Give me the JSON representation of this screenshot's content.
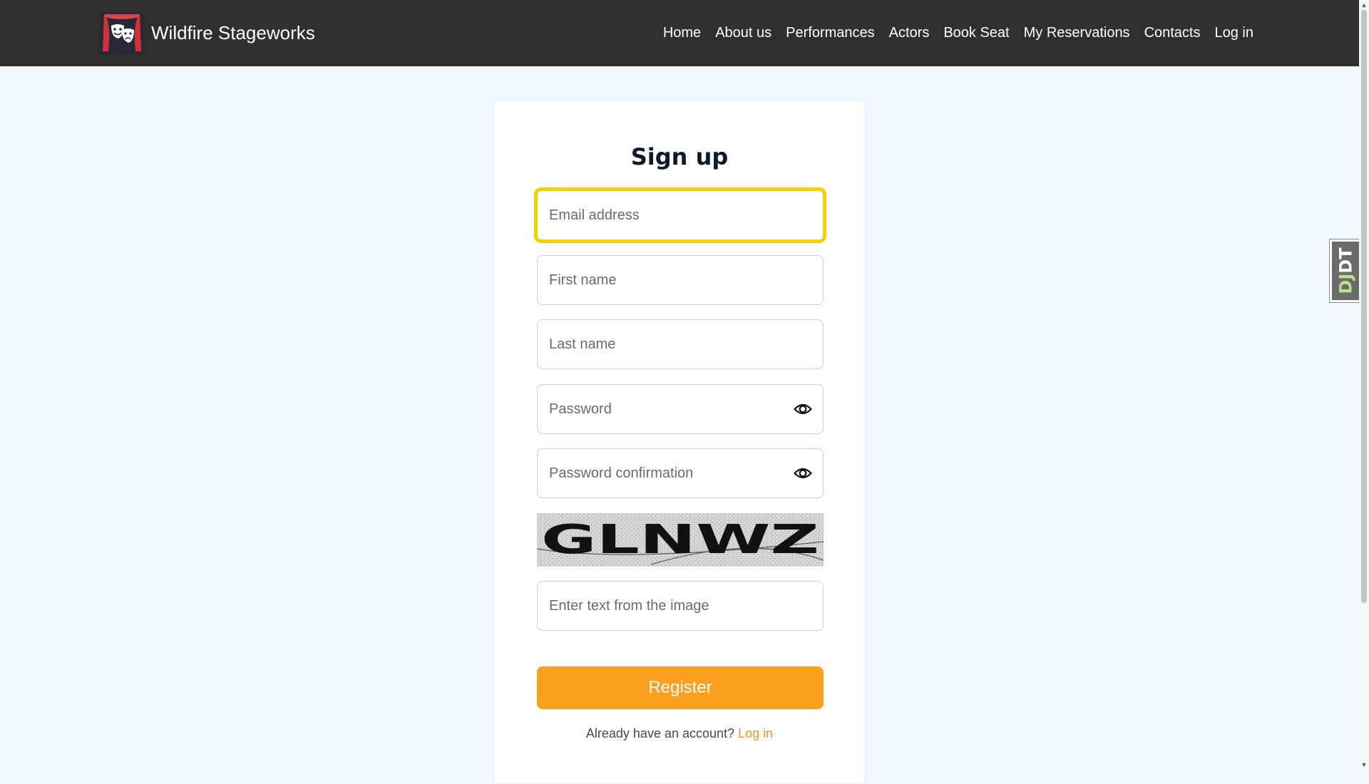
{
  "navbar": {
    "brand": "Wildfire Stageworks",
    "logo_icon": "theater-masks-icon",
    "items": [
      {
        "label": "Home"
      },
      {
        "label": "About us"
      },
      {
        "label": "Performances"
      },
      {
        "label": "Actors"
      },
      {
        "label": "Book Seat"
      },
      {
        "label": "My Reservations"
      },
      {
        "label": "Contacts"
      },
      {
        "label": "Log in"
      }
    ]
  },
  "form": {
    "title": "Sign up",
    "email_placeholder": "Email address",
    "first_name_placeholder": "First name",
    "last_name_placeholder": "Last name",
    "password_placeholder": "Password",
    "password_confirmation_placeholder": "Password confirmation",
    "captcha_text": "GLNWZ",
    "captcha_input_placeholder": "Enter text from the image",
    "register_label": "Register",
    "login_prompt": "Already have an account?",
    "login_link": "Log in"
  },
  "debug_toolbar": {
    "label_prefix": "DJ",
    "label_suffix": "DT"
  },
  "colors": {
    "navbar_bg": "#2f2f2f",
    "page_bg": "#f0f7fd",
    "focus_ring": "#f5d000",
    "primary_button": "#fb9f1c",
    "link": "#f0951a"
  }
}
